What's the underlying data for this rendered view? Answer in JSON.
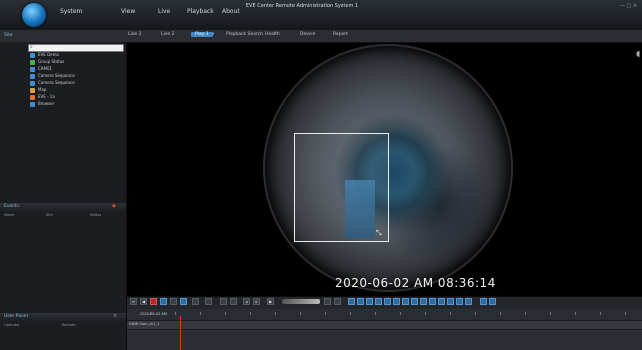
{
  "app": {
    "title": "EVE Center Remote Administration System 1",
    "window_controls": "— □ ×"
  },
  "menu": [
    "System",
    "View",
    "Live",
    "Playback",
    "About"
  ],
  "tabs": [
    {
      "label": "Live 1",
      "active": false
    },
    {
      "label": "Live 2",
      "active": false
    },
    {
      "label": "Play 1",
      "active": true
    },
    {
      "label": "Playback Search",
      "active": false
    },
    {
      "label": "Health",
      "active": false
    },
    {
      "label": "Device",
      "active": false
    },
    {
      "label": "Report",
      "active": false
    }
  ],
  "site": {
    "header": "Site",
    "search_placeholder": "",
    "tree": [
      {
        "label": "EVE Demo",
        "icon": "site-icon",
        "color": "#3f8fd6"
      },
      {
        "label": "Group Status",
        "icon": "group-icon",
        "color": "#4caf50"
      },
      {
        "label": "CAM01",
        "icon": "camera-icon",
        "color": "#3f8fd6"
      },
      {
        "label": "Camera Sequence",
        "icon": "sequence-icon",
        "color": "#3f8fd6"
      },
      {
        "label": "Camera Sequence",
        "icon": "sequence-icon",
        "color": "#3f8fd6"
      },
      {
        "label": "Map",
        "icon": "map-icon",
        "color": "#e0a030"
      },
      {
        "label": "EVE - 1a",
        "icon": "group-icon",
        "color": "#e07030"
      },
      {
        "label": "Browser",
        "icon": "browser-icon",
        "color": "#3f8fd6"
      }
    ]
  },
  "event": {
    "header": "Event",
    "columns": [
      "Name",
      "Site",
      "Status"
    ]
  },
  "user_panel": {
    "header": "User Panel",
    "columns": [
      "Operator",
      "Remote"
    ]
  },
  "video": {
    "timestamp": "2020-06-02 AM 08:36:14"
  },
  "timeline": {
    "time": "2020-06-02 AM",
    "camera": "HDMI Cam_ch1_1"
  },
  "accent": "#3e86c6"
}
